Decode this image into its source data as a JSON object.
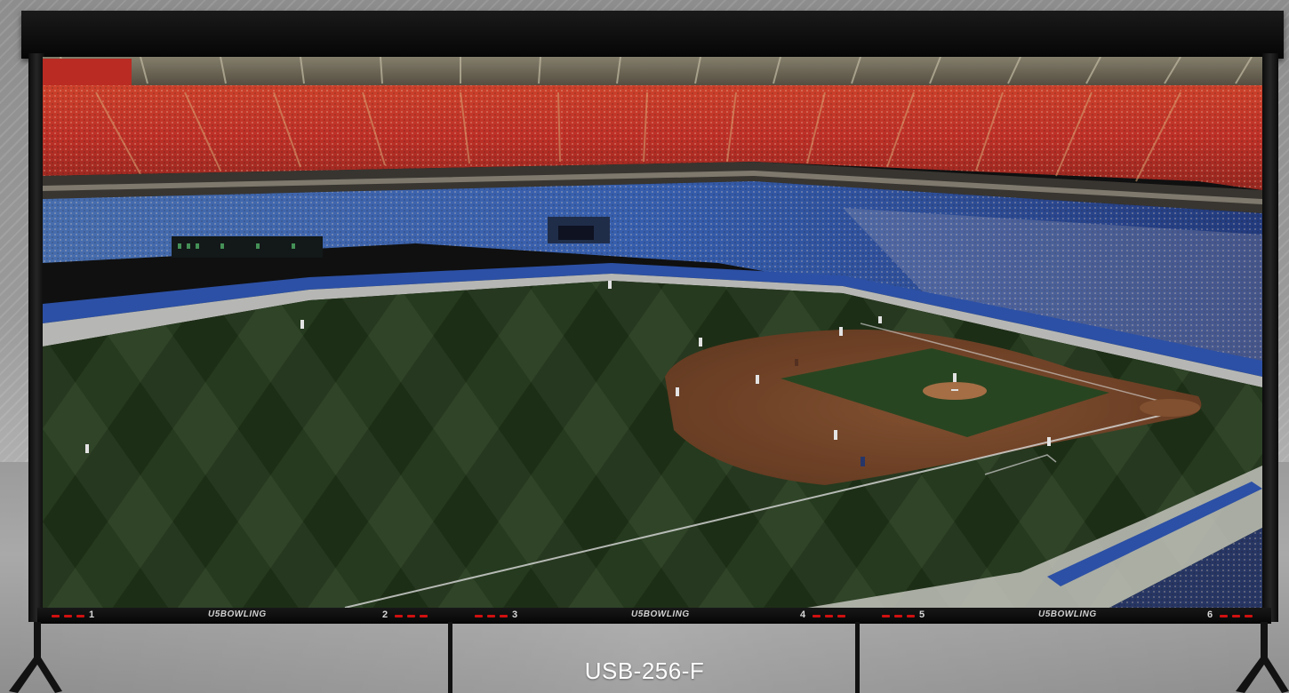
{
  "product": {
    "model": "USB-256-F"
  },
  "panels": [
    {
      "number": "1"
    },
    {
      "number": "2"
    },
    {
      "number": "3"
    },
    {
      "number": "4"
    },
    {
      "number": "5"
    },
    {
      "number": "6"
    }
  ],
  "logos": [
    {
      "text": "U5BOWLING"
    },
    {
      "text": "U5BOWLING"
    },
    {
      "text": "U5BOWLING"
    }
  ],
  "colors": {
    "upper_seats": "#c9332a",
    "lower_seats": "#3a64b8",
    "grass": "#24381c",
    "infield_dirt": "#7a4a2c",
    "frame": "#0a0a0a",
    "led": "#d01010"
  },
  "screen_image": {
    "subject": "baseball stadium"
  }
}
